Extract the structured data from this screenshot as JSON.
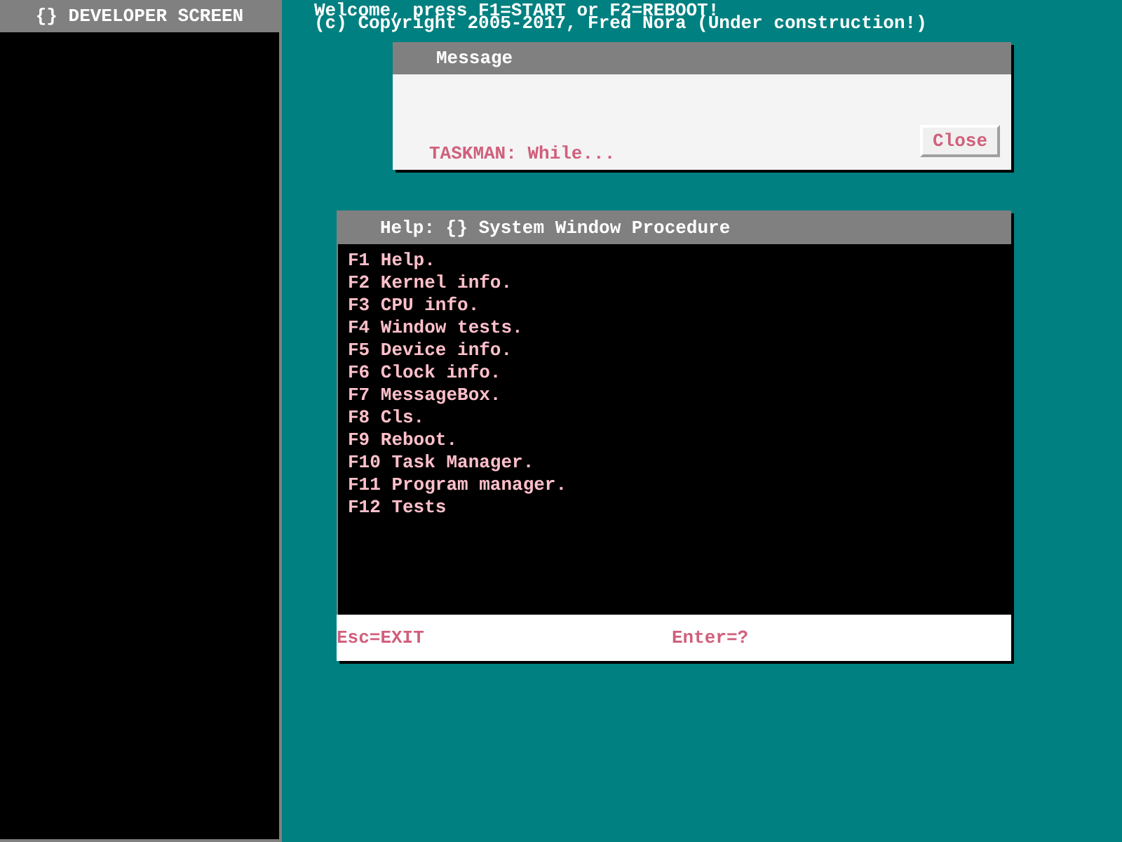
{
  "developer_panel": {
    "title": "{} DEVELOPER SCREEN"
  },
  "desktop_text": [
    "Welcome, press F1=START or F2=REBOOT!",
    "(c) Copyright 2005-2017, Fred Nora (Under construction!)"
  ],
  "message_window": {
    "title": "Message",
    "text": "TASKMAN: While...",
    "button": "Close"
  },
  "help_window": {
    "title": "Help: {} System Window Procedure",
    "items": [
      "F1 Help.",
      "F2 Kernel info.",
      "F3 CPU info.",
      "F4 Window tests.",
      "F5 Device info.",
      "F6 Clock info.",
      "F7 MessageBox.",
      "F8 Cls.",
      "F9 Reboot.",
      "F10 Task Manager.",
      "F11 Program manager.",
      "F12 Tests"
    ],
    "footer": [
      "Esc=EXIT",
      "Enter=?"
    ]
  }
}
